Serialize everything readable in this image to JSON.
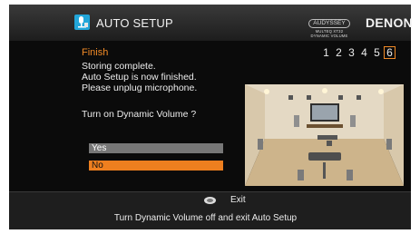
{
  "header": {
    "title": "AUTO SETUP",
    "icon": "auto-setup-mic-icon",
    "audyssey_brand": "AUDYSSEY",
    "audyssey_sub1": "MULTEQ XT32",
    "audyssey_sub2": "DYNAMIC VOLUME",
    "brand": "DENON"
  },
  "step": {
    "title": "Finish",
    "numbers": [
      "1",
      "2",
      "3",
      "4",
      "5",
      "6"
    ],
    "active_index": 5
  },
  "message": {
    "lines": [
      "Storing complete.",
      "Auto Setup is now finished.",
      "Please unplug microphone."
    ],
    "question": "Turn on Dynamic Volume ?"
  },
  "options": {
    "yes": "Yes",
    "no": "No",
    "selected": "No"
  },
  "footer": {
    "enter_icon": "enter-button-icon",
    "exit_label": "Exit",
    "hint": "Turn Dynamic Volume off and exit Auto Setup"
  },
  "colors": {
    "accent": "#ee7f1f",
    "icon_blue": "#22a6d9",
    "background": "#0b0b0b"
  }
}
